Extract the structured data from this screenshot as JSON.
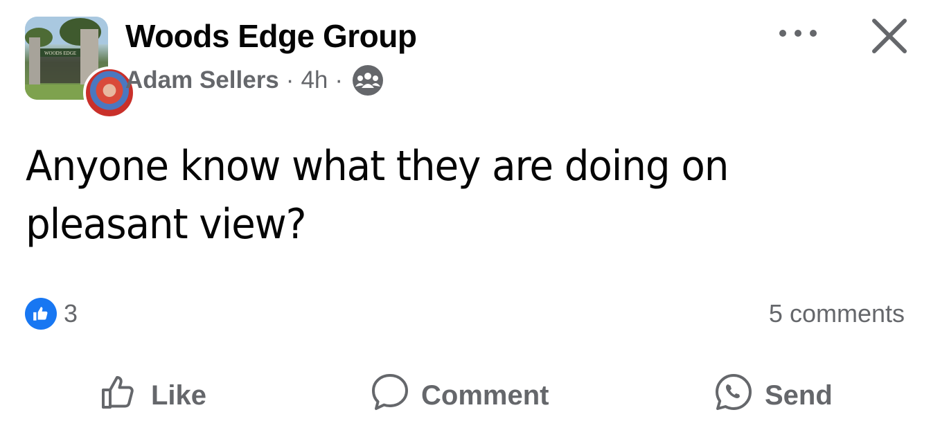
{
  "post": {
    "group_name": "Woods Edge Group",
    "author": "Adam Sellers",
    "separator": "·",
    "time": "4h",
    "avatar_sign_text": "WOODS EDGE",
    "text": "Anyone know what they are doing on pleasant view?"
  },
  "reactions": {
    "count": "3",
    "comments": "5 comments"
  },
  "actions": {
    "like": "Like",
    "comment": "Comment",
    "send": "Send"
  },
  "icons": {
    "privacy": "group-members-icon",
    "more": "more-options-icon",
    "close": "close-icon"
  },
  "colors": {
    "accent": "#1877f2",
    "secondary_text": "#65676b",
    "primary_text": "#050505"
  }
}
